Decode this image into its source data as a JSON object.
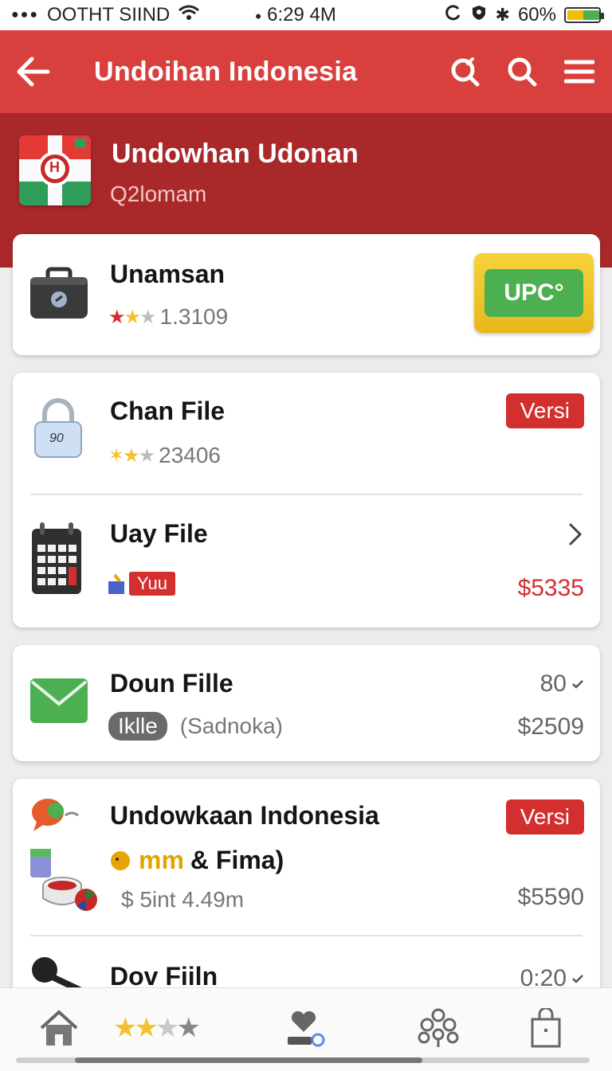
{
  "status_bar": {
    "carrier": "OOTHT SIIND",
    "time": "6:29 4M",
    "battery": "60%"
  },
  "app_bar": {
    "title": "Undoihan Indonesia"
  },
  "header": {
    "title": "Undowhan Udonan",
    "subtitle": "Q2lomam",
    "logo_letter": "H"
  },
  "cards": {
    "card1": {
      "title": "Unamsan",
      "rating_value": "1.3109",
      "button_label": "UPC°",
      "stars": {
        "filled": 1.5,
        "total": 3
      }
    },
    "card2": {
      "item1": {
        "title": "Chan File",
        "rating_value": "23406",
        "badge": "Versi",
        "lock_text": "90"
      },
      "item2": {
        "title": "Uay File",
        "tag": "Yuu",
        "price": "$5335"
      }
    },
    "card3": {
      "title": "Doun Fille",
      "pill": "Iklle",
      "subtitle": "(Sadnoka)",
      "count": "80",
      "price": "$2509"
    },
    "card4": {
      "item1": {
        "title": "Undowkaan Indonesia",
        "badge": "Versi",
        "line2_highlight": "mm",
        "line2_rest": "& Fima)",
        "meta": "$ 5int  4.49m",
        "price": "$5590"
      },
      "item2": {
        "title": "Dov Fiiln",
        "count": "0:20"
      }
    }
  },
  "bottom_nav": {
    "stars": {
      "filled": 2,
      "total": 4
    }
  },
  "colors": {
    "app_bar": "#d93f3c",
    "header": "#a9292a",
    "badge": "#d32f2f",
    "upc_green": "#4caf50",
    "upc_yellow": "#f2c52c"
  }
}
